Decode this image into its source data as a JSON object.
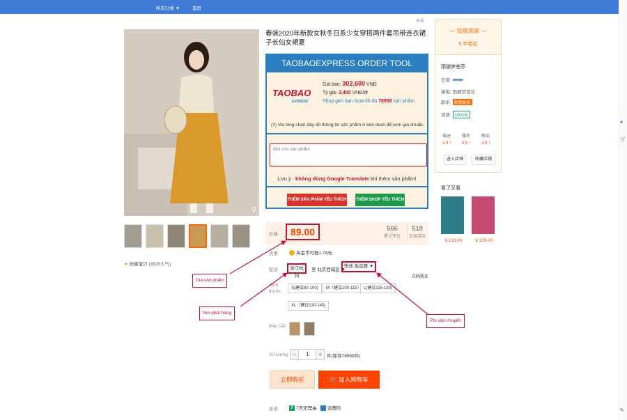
{
  "topbar": {
    "categories": "所有分类 ▼",
    "home": "首页"
  },
  "product": {
    "title": "春装2020年新款女秋冬日系少女穿搭两件套吊带连衣裙子长仙女裙夏",
    "report": "举报",
    "favorite": "收藏宝贝 (3520人气)"
  },
  "tool": {
    "header": "TAOBAOEXPRESS ORDER TOOL",
    "logo": "TAOBAO",
    "logo_sub": "EXPRESS",
    "price_label": "Giá bán:",
    "price_value": "302,600",
    "price_unit": "VNĐ",
    "rate_label": "Tỷ giá:",
    "rate_value": "3,400",
    "rate_unit": "VNĐ/tệ",
    "limit_pre": "Shop giới hạn mua tối đa",
    "limit_value": "78958",
    "limit_post": "sản phẩm",
    "note": "(!!) Vui lòng chọn đầy đủ thông tin sản phẩm ở bên dưới để xem giá chuẩn.",
    "notes_placeholder": "Ghi chú sản phẩm",
    "warn_pre": "Lưu ý :",
    "warn_bold": "không dùng Google Translate",
    "warn_post": "khi thêm sản phẩm!",
    "btn_fav_product": "THÊM SẢN PHẨM YÊU THÍCH",
    "btn_fav_shop": "THÊM SHOP YÊU THÍCH"
  },
  "price": {
    "label": "价格",
    "value": "89.00",
    "reviews_count": "566",
    "reviews_label": "累计评论",
    "sales_count": "518",
    "sales_label": "交易成功"
  },
  "promo": {
    "label": "优惠",
    "text": "淘金币可抵1.78元"
  },
  "shipping": {
    "label": "配送",
    "origin": "浙江杭州",
    "dest": "至 北京西城区 ▼",
    "fee": "快递 免运费 ▼",
    "only": "只码购买"
  },
  "size": {
    "label": "Kích thước",
    "options": [
      "S(建议80-100)",
      "M（建议100-115）",
      "L(建议115-130)",
      "XL（建议130-145)"
    ]
  },
  "color": {
    "label": "Màu sắc"
  },
  "quantity": {
    "label": "Số lượng",
    "minus": "−",
    "value": "1",
    "plus": "+",
    "stock": "件(库存78958件)"
  },
  "actions": {
    "buy_now": "立即购买",
    "add_cart": "加入购物车"
  },
  "promise": {
    "label": "承诺",
    "item1_icon": "7",
    "item1": "7天无理由",
    "item2": "运费险"
  },
  "seller": {
    "level": "钻级卖家",
    "years": "6 年老店",
    "name": "雨娜梦苍莎",
    "credit_label": "信誉:",
    "credit_hearts": "♥♥♥♥♥",
    "keeper_label": "掌柜:",
    "keeper": "雨娜梦苍莎",
    "contact_label": "联系:",
    "contact": "和我联系",
    "qual_label": "资质:",
    "qual": "1000元",
    "r1_label": "描述",
    "r1": "4.9 ↑",
    "r2_label": "服务",
    "r2": "4.9 ↑",
    "r3_label": "物流",
    "r3": "4.9 ↑",
    "enter_shop": "进入店铺",
    "fav_shop": "收藏店铺"
  },
  "watched": {
    "title": "看了又看",
    "items": [
      {
        "price": "￥129.00"
      },
      {
        "price": "￥129.00"
      }
    ]
  },
  "annotations": {
    "price": "Giá sản phẩm",
    "origin": "Nơi phát hàng",
    "shipping": "Phí vận chuyển"
  },
  "colors": {
    "accent": "#ff4400",
    "annotation": "#c8102e",
    "tool_blue": "#2a7fc3",
    "topbar": "#3f7ad6"
  }
}
